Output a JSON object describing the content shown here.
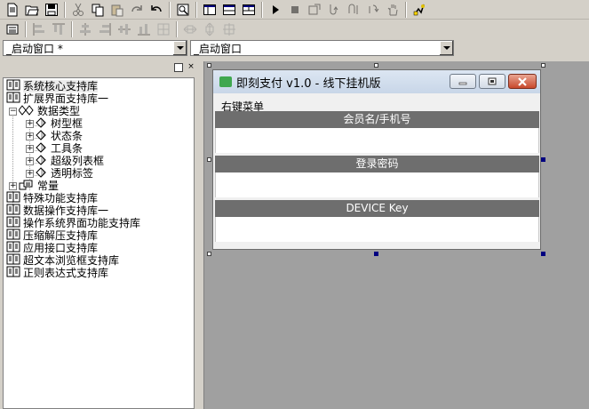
{
  "toolbar_row1": {
    "icons": [
      "new-file-icon",
      "open-folder-icon",
      "save-icon",
      "cut-icon",
      "copy-icon",
      "paste-icon",
      "redo-icon",
      "undo-icon",
      "find-icon",
      "layout-window-icon",
      "layout-top-icon",
      "layout-split-icon",
      "run-icon",
      "stop-icon",
      "step-icon",
      "step-into-icon",
      "step-over-icon",
      "step-out-icon",
      "hand-icon",
      "debug-icon"
    ]
  },
  "toolbar_row2": {
    "icons": [
      "grid-icon",
      "align-left-icon",
      "align-top-icon",
      "align-center-icon",
      "align-right-icon",
      "align-middle-icon",
      "align-bottom-icon",
      "align-vcenter-icon",
      "same-width-icon",
      "same-height-icon",
      "same-size-icon"
    ]
  },
  "combo_left": {
    "value": "_启动窗口 *"
  },
  "combo_right": {
    "value": "_启动窗口"
  },
  "panel": {
    "min_label": "▫",
    "close_label": "×"
  },
  "tree": {
    "items": [
      {
        "label": "系统核心支持库",
        "selected": true
      },
      {
        "label": "扩展界面支持库一"
      },
      {
        "label": "数据类型"
      },
      {
        "label": "树型框"
      },
      {
        "label": "状态条"
      },
      {
        "label": "工具条"
      },
      {
        "label": "超级列表框"
      },
      {
        "label": "透明标签"
      },
      {
        "label": "常量"
      },
      {
        "label": "特殊功能支持库"
      },
      {
        "label": "数据操作支持库一"
      },
      {
        "label": "操作系统界面功能支持库"
      },
      {
        "label": "压缩解压支持库"
      },
      {
        "label": "应用接口支持库"
      },
      {
        "label": "超文本浏览框支持库"
      },
      {
        "label": "正则表达式支持库"
      }
    ],
    "expanders": {
      "plus": "+",
      "minus": "−"
    }
  },
  "form": {
    "title": "即刻支付 v1.0 - 线下挂机版",
    "right_menu": "右键菜单",
    "labels": [
      "会员名/手机号",
      "登录密码",
      "DEVICE Key"
    ],
    "colors": {
      "bar": "#6e6e6e",
      "title_bar": "#dce6f2",
      "close": "#c8482c",
      "icon": "#3fa74f"
    }
  }
}
